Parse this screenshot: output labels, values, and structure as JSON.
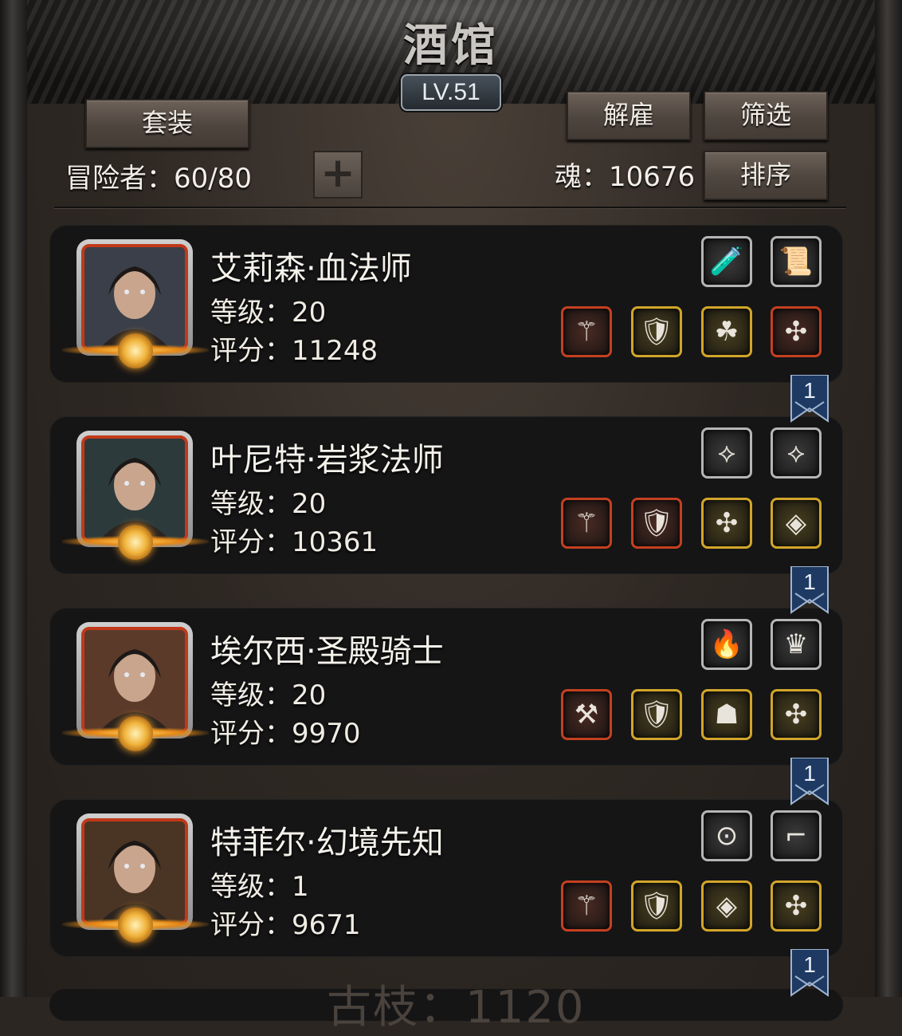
{
  "header": {
    "title": "酒馆",
    "level": "LV.51",
    "suit_button": "套装",
    "dismiss_button": "解雇",
    "filter_button": "筛选",
    "sort_button": "排序",
    "adventurers_label": "冒险者：60/80",
    "soul_label": "魂：10676",
    "add_button": "+"
  },
  "heroes": [
    {
      "name": "艾莉森·血法师",
      "level": "等级：20",
      "score": "评分：11248",
      "ribbon": "1",
      "top_items": [
        {
          "icon": "potion-icon",
          "glyph": "🧪",
          "frame": "gray"
        },
        {
          "icon": "scroll-icon",
          "glyph": "📜",
          "frame": "gray"
        }
      ],
      "bottom_items": [
        {
          "icon": "staff-icon",
          "glyph": "⚚",
          "frame": "red"
        },
        {
          "icon": "armor-icon",
          "glyph": "🛡",
          "frame": "gold"
        },
        {
          "icon": "herb-icon",
          "glyph": "☘",
          "frame": "gold"
        },
        {
          "icon": "amulet-icon",
          "glyph": "✣",
          "frame": "red"
        }
      ]
    },
    {
      "name": "叶尼特·岩浆法师",
      "level": "等级：20",
      "score": "评分：10361",
      "ribbon": "1",
      "top_items": [
        {
          "icon": "bracer-icon",
          "glyph": "⟡",
          "frame": "gray"
        },
        {
          "icon": "bracer-icon",
          "glyph": "⟡",
          "frame": "gray"
        }
      ],
      "bottom_items": [
        {
          "icon": "staff-icon",
          "glyph": "⚚",
          "frame": "red"
        },
        {
          "icon": "armor-icon",
          "glyph": "🛡",
          "frame": "red"
        },
        {
          "icon": "amulet-icon",
          "glyph": "✣",
          "frame": "gold"
        },
        {
          "icon": "rune-tile-icon",
          "glyph": "◈",
          "frame": "gold"
        }
      ]
    },
    {
      "name": "埃尔西·圣殿骑士",
      "level": "等级：20",
      "score": "评分：9970",
      "ribbon": "1",
      "top_items": [
        {
          "icon": "feather-icon",
          "glyph": "🔥",
          "frame": "gray"
        },
        {
          "icon": "crystal-comb-icon",
          "glyph": "♛",
          "frame": "gray"
        }
      ],
      "bottom_items": [
        {
          "icon": "hammer-icon",
          "glyph": "⚒",
          "frame": "red"
        },
        {
          "icon": "armor-icon",
          "glyph": "🛡",
          "frame": "gold"
        },
        {
          "icon": "mask-icon",
          "glyph": "☗",
          "frame": "gold"
        },
        {
          "icon": "amulet-icon",
          "glyph": "✣",
          "frame": "gold"
        }
      ]
    },
    {
      "name": "特菲尔·幻境先知",
      "level": "等级：1",
      "score": "评分：9671",
      "ribbon": "1",
      "top_items": [
        {
          "icon": "goggles-icon",
          "glyph": "⊙",
          "frame": "gray"
        },
        {
          "icon": "pipe-icon",
          "glyph": "⌐",
          "frame": "gray"
        }
      ],
      "bottom_items": [
        {
          "icon": "scepter-icon",
          "glyph": "⚚",
          "frame": "red"
        },
        {
          "icon": "armor-icon",
          "glyph": "🛡",
          "frame": "gold"
        },
        {
          "icon": "rune-tile-icon",
          "glyph": "◈",
          "frame": "gold"
        },
        {
          "icon": "amulet-icon",
          "glyph": "✣",
          "frame": "gold"
        }
      ]
    }
  ]
}
